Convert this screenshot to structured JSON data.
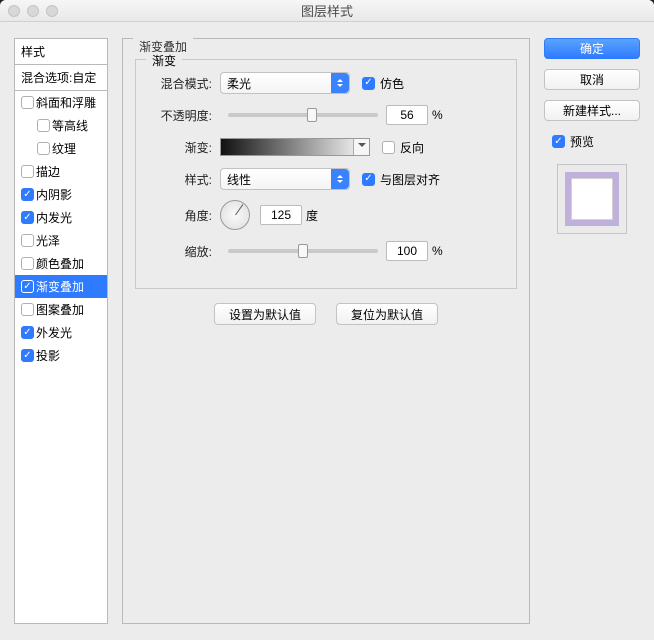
{
  "window": {
    "title": "图层样式"
  },
  "sidebar": {
    "heading": "样式",
    "subheading": "混合选项:自定",
    "items": [
      {
        "label": "斜面和浮雕",
        "checked": false,
        "indent": false
      },
      {
        "label": "等高线",
        "checked": false,
        "indent": true
      },
      {
        "label": "纹理",
        "checked": false,
        "indent": true
      },
      {
        "label": "描边",
        "checked": false,
        "indent": false
      },
      {
        "label": "内阴影",
        "checked": true,
        "indent": false
      },
      {
        "label": "内发光",
        "checked": true,
        "indent": false
      },
      {
        "label": "光泽",
        "checked": false,
        "indent": false
      },
      {
        "label": "颜色叠加",
        "checked": false,
        "indent": false
      },
      {
        "label": "渐变叠加",
        "checked": true,
        "indent": false,
        "selected": true
      },
      {
        "label": "图案叠加",
        "checked": false,
        "indent": false
      },
      {
        "label": "外发光",
        "checked": true,
        "indent": false
      },
      {
        "label": "投影",
        "checked": true,
        "indent": false
      }
    ]
  },
  "panel": {
    "title": "渐变叠加",
    "group": "渐变",
    "blendmode_label": "混合模式:",
    "blendmode": "柔光",
    "dither_label": "仿色",
    "dither_checked": true,
    "opacity_label": "不透明度:",
    "opacity": "56",
    "opacity_pct": 56,
    "gradient_label": "渐变:",
    "reverse_label": "反向",
    "reverse_checked": false,
    "style_label": "样式:",
    "style": "线性",
    "align_label": "与图层对齐",
    "align_checked": true,
    "angle_label": "角度:",
    "angle": "125",
    "angle_unit": "度",
    "scale_label": "缩放:",
    "scale": "100",
    "scale_pct": 50,
    "percent": "%",
    "set_default": "设置为默认值",
    "reset_default": "复位为默认值"
  },
  "buttons": {
    "ok": "确定",
    "cancel": "取消",
    "new_style": "新建样式...",
    "preview": "预览"
  }
}
